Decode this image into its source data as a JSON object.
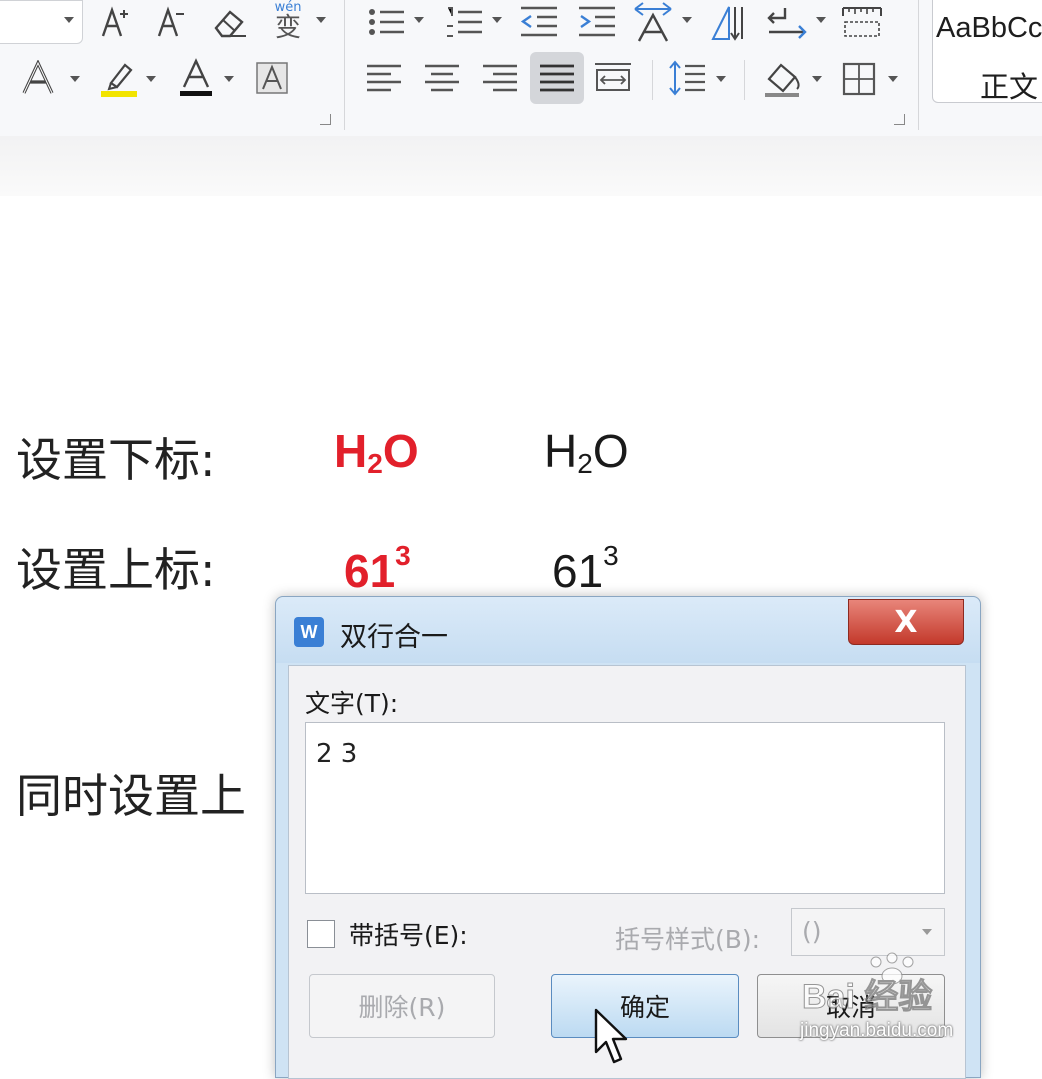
{
  "ribbon": {
    "style_sample": "AaBbCc",
    "style_name": "正文",
    "phonetic_label": "wén",
    "phonetic_char": "变"
  },
  "document": {
    "subscript_label": "设置下标:",
    "superscript_label": "设置上标:",
    "both_label_partial": "同时设置上",
    "h2o_red": {
      "base": "H",
      "sub": "2",
      "tail": "O"
    },
    "h2o_black": {
      "base": "H",
      "sub": "2",
      "tail": "O"
    },
    "sup_red": {
      "base": "61",
      "sup": "3"
    },
    "sup_black": {
      "base": "61",
      "sup": "3"
    }
  },
  "dialog": {
    "title": "双行合一",
    "app_icon_letter": "W",
    "close_label": "X",
    "text_label": "文字(T):",
    "text_value": "2 3",
    "bracket_checkbox_label": "带括号(E):",
    "bracket_style_label": "括号样式(B):",
    "bracket_style_value": "()",
    "delete_button": "删除(R)",
    "ok_button": "确定",
    "cancel_button": "取消"
  },
  "watermark": {
    "brand": "Bai 经验",
    "url": "jingyan.baidu.com"
  }
}
